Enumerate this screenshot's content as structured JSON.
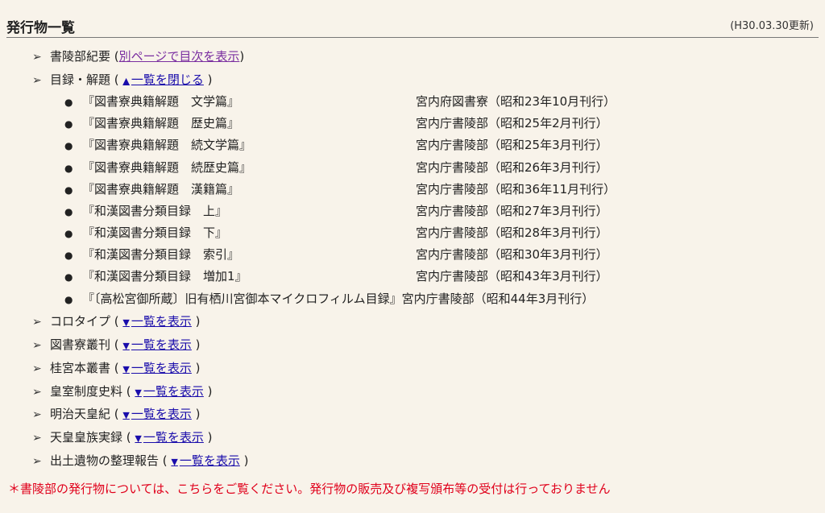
{
  "header": {
    "title": "発行物一覧",
    "updated": "(H30.03.30更新)"
  },
  "icons": {
    "arrow": "➢",
    "bullet": "●",
    "tri_up": "▲",
    "tri_down": "▼"
  },
  "sections": [
    {
      "label": "書陵部紀要",
      "link": "別ページで目次を表示"
    },
    {
      "label": "目録・解題",
      "link": "一覧を閉じる"
    },
    {
      "label": "コロタイプ",
      "link": "一覧を表示"
    },
    {
      "label": "図書寮叢刊",
      "link": "一覧を表示"
    },
    {
      "label": "桂宮本叢書",
      "link": "一覧を表示"
    },
    {
      "label": "皇室制度史料",
      "link": "一覧を表示"
    },
    {
      "label": "明治天皇紀",
      "link": "一覧を表示"
    },
    {
      "label": "天皇皇族実録",
      "link": "一覧を表示"
    },
    {
      "label": "出土遺物の整理報告",
      "link": "一覧を表示"
    }
  ],
  "catalog_items": [
    {
      "title": "『図書寮典籍解題　文学篇』",
      "publisher": "宮内府図書寮（昭和23年10月刊行）"
    },
    {
      "title": "『図書寮典籍解題　歴史篇』",
      "publisher": "宮内庁書陵部（昭和25年2月刊行）"
    },
    {
      "title": "『図書寮典籍解題　続文学篇』",
      "publisher": "宮内庁書陵部（昭和25年3月刊行）"
    },
    {
      "title": "『図書寮典籍解題　続歴史篇』",
      "publisher": "宮内庁書陵部（昭和26年3月刊行）"
    },
    {
      "title": "『図書寮典籍解題　漢籍篇』",
      "publisher": "宮内庁書陵部（昭和36年11月刊行）"
    },
    {
      "title": "『和漢図書分類目録　上』",
      "publisher": "宮内庁書陵部（昭和27年3月刊行）"
    },
    {
      "title": "『和漢図書分類目録　下』",
      "publisher": "宮内庁書陵部（昭和28年3月刊行）"
    },
    {
      "title": "『和漢図書分類目録　索引』",
      "publisher": "宮内庁書陵部（昭和30年3月刊行）"
    },
    {
      "title": "『和漢図書分類目録　増加1』",
      "publisher": "宮内庁書陵部（昭和43年3月刊行）"
    },
    {
      "title": "『〔高松宮御所蔵〕旧有栖川宮御本マイクロフィルム目録』宮内庁書陵部（昭和44年3月刊行）",
      "publisher": ""
    }
  ],
  "note": "＊書陵部の発行物については、こちらをご覧ください。発行物の販売及び複写頒布等の受付は行っておりません",
  "colors": {
    "background": "#f8f3ea",
    "link": "#1a0dab",
    "visited": "#7a2ea0",
    "note": "#e0001b"
  }
}
